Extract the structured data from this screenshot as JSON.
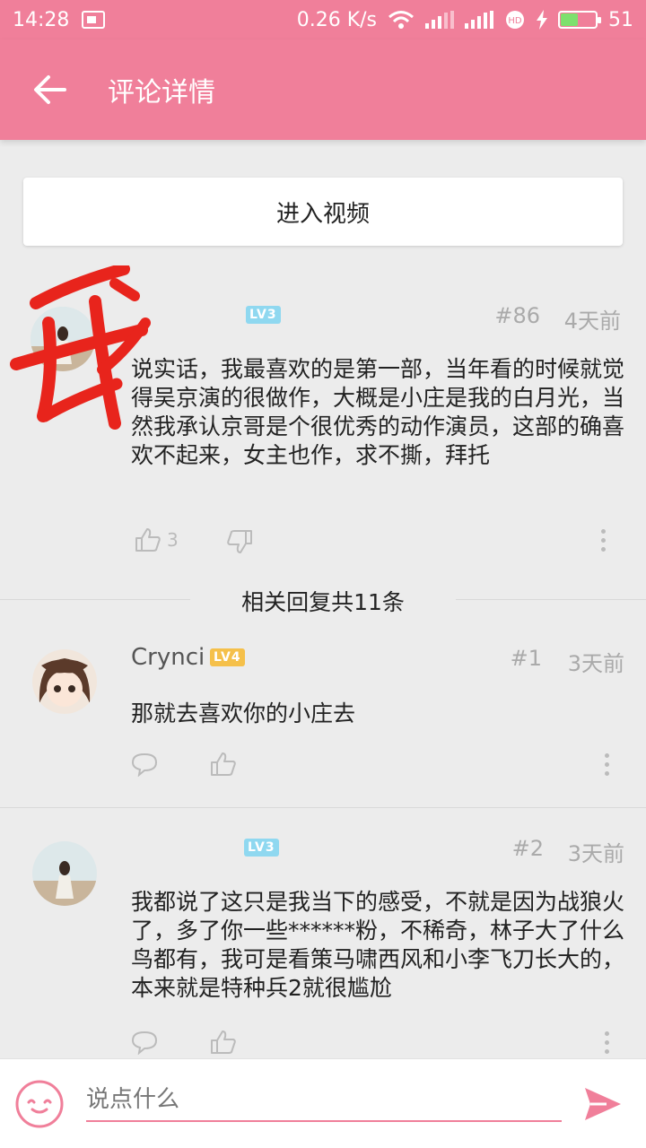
{
  "status_bar": {
    "time": "14:28",
    "network_speed": "0.26 K/s",
    "battery": "51",
    "battery_level": 0.51
  },
  "header": {
    "title": "评论详情",
    "back_icon": "arrow-left-icon"
  },
  "enter_video_label": "进入视频",
  "main_comment": {
    "username": "",
    "level": "LV3",
    "floor": "#86",
    "time": "4天前",
    "text": "说实话，我最喜欢的是第一部，当年看的时候就觉得吴京演的很做作，大概是小庄是我的白月光，当然我承认京哥是个很优秀的动作演员，这部的确喜欢不起来，女主也作，求不撕，拜托",
    "likes": "3",
    "annotation": "我"
  },
  "reply_count_label": "相关回复共11条",
  "replies": [
    {
      "username": "Crynci",
      "level": "LV4",
      "floor": "#1",
      "time": "3天前",
      "text": "那就去喜欢你的小庄去"
    },
    {
      "username": "",
      "level": "LV3",
      "floor": "#2",
      "time": "3天前",
      "text": "我都说了这只是我当下的感受，不就是因为战狼火了，多了你一些******粉，不稀奇，林子大了什么鸟都有，我可是看策马啸西风和小李飞刀长大的，本来就是特种兵2就很尴尬"
    }
  ],
  "comment_input": {
    "placeholder": "说点什么"
  },
  "colors": {
    "accent": "#f07f9a",
    "background": "#ececec",
    "lv3": "#8fd8f0",
    "lv4": "#f5c04a"
  }
}
